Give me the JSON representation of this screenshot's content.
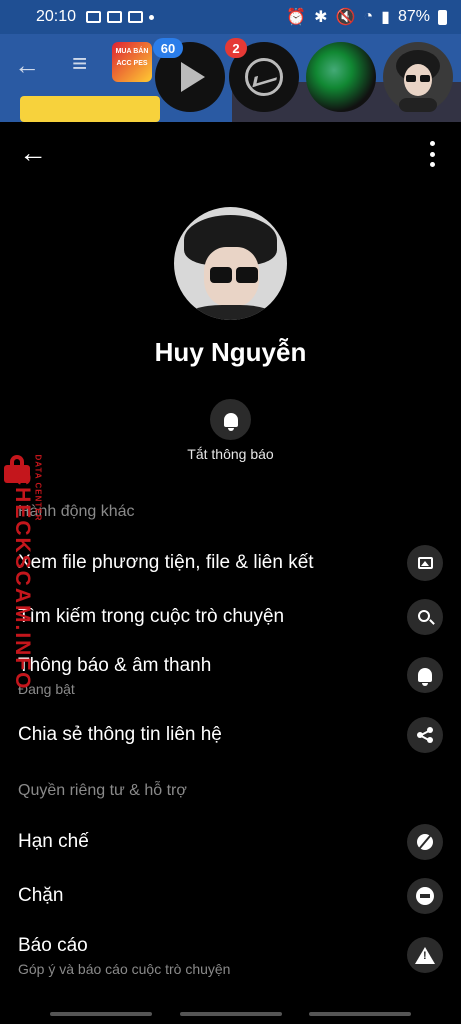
{
  "status_bar": {
    "time": "20:10",
    "battery": "87%"
  },
  "background_app": {
    "game_label": "MUA BÁN ACC PES"
  },
  "chat_heads": {
    "badge_video": "60",
    "badge_messenger": "2"
  },
  "profile": {
    "name": "Huy Nguyễn"
  },
  "quick_action": {
    "mute_label": "Tắt thông báo"
  },
  "sections": {
    "more_actions": "Hành động khác",
    "privacy": "Quyền riêng tư & hỗ trợ"
  },
  "items": {
    "media": {
      "label": "Xem file phương tiện, file & liên kết"
    },
    "search": {
      "label": "Tìm kiếm trong cuộc trò chuyện"
    },
    "notifications": {
      "label": "Thông báo & âm thanh",
      "sub": "Đang bật"
    },
    "share": {
      "label": "Chia sẻ thông tin liên hệ"
    },
    "restrict": {
      "label": "Hạn chế"
    },
    "block": {
      "label": "Chặn"
    },
    "report": {
      "label": "Báo cáo",
      "sub": "Góp ý và báo cáo cuộc trò chuyện"
    }
  },
  "watermark": {
    "brand": "CHECKSCAM.INFO",
    "tagline": "DATA CENTER"
  },
  "colors": {
    "status_bar": "#1f4f93",
    "background": "#000000",
    "watermark": "#c4161c",
    "badge_blue": "#2b7de9",
    "badge_red": "#e53935"
  }
}
